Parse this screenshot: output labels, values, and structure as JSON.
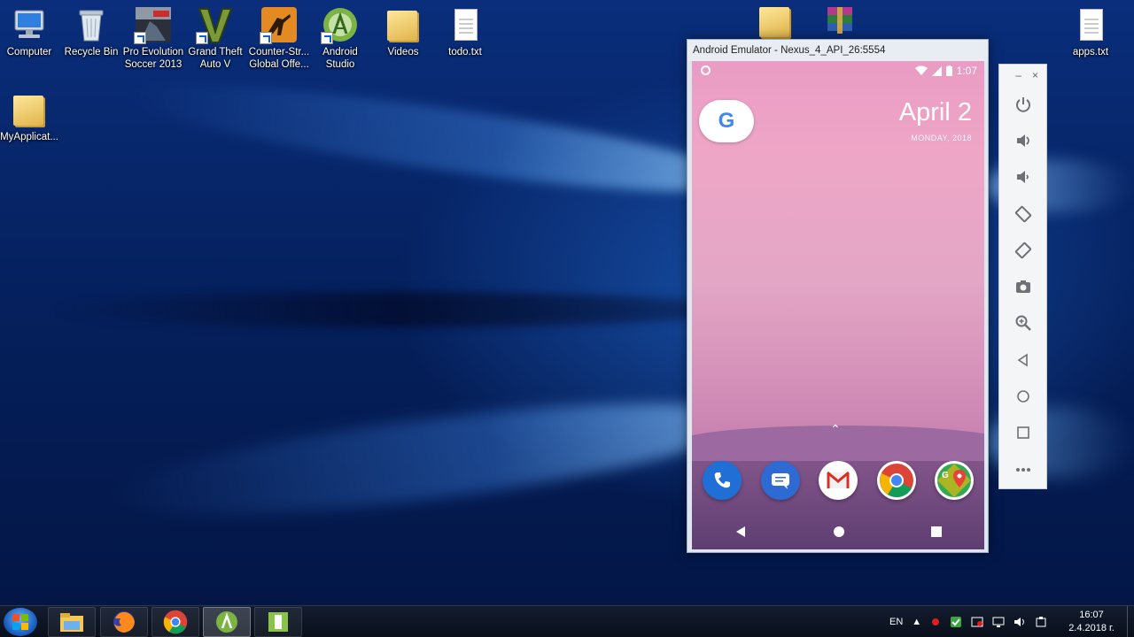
{
  "desktop": {
    "icons": [
      {
        "label": "Computer",
        "icon": "computer-icon"
      },
      {
        "label": "Recycle Bin",
        "icon": "recycle-bin-icon"
      },
      {
        "label_line1": "Pro Evolution",
        "label_line2": "Soccer 2013",
        "icon": "pes-game-icon"
      },
      {
        "label_line1": "Grand Theft",
        "label_line2": "Auto V",
        "icon": "gta-v-icon"
      },
      {
        "label_line1": "Counter-Str...",
        "label_line2": "Global Offe...",
        "icon": "csgo-icon"
      },
      {
        "label_line1": "Android",
        "label_line2": "Studio",
        "icon": "android-studio-icon"
      },
      {
        "label": "Videos",
        "icon": "folder-icon"
      },
      {
        "label": "todo.txt",
        "icon": "text-file-icon"
      },
      {
        "label": "apps.txt",
        "icon": "text-file-icon"
      },
      {
        "label": "MyApplicat...",
        "icon": "folder-icon"
      }
    ]
  },
  "emulator": {
    "window_title": "Android Emulator - Nexus_4_API_26:5554",
    "status_time": "1:07",
    "date_main": "April 2",
    "date_sub": "MONDAY, 2018",
    "google_letter": "G",
    "dock_apps": [
      "phone-app-icon",
      "messages-app-icon",
      "gmail-app-icon",
      "chrome-app-icon",
      "maps-app-icon"
    ],
    "toolbar": {
      "minimize": "–",
      "close": "×",
      "buttons": [
        "power-icon",
        "volume-up-icon",
        "volume-down-icon",
        "rotate-left-icon",
        "rotate-right-icon",
        "camera-icon",
        "zoom-icon",
        "back-icon",
        "home-icon",
        "overview-icon",
        "more-icon"
      ]
    }
  },
  "taskbar": {
    "apps": [
      "explorer-icon",
      "firefox-icon",
      "chrome-icon",
      "android-studio-taskbar-icon",
      "emulator-taskbar-icon"
    ],
    "language": "EN",
    "time": "16:07",
    "date": "2.4.2018 г."
  },
  "colors": {
    "wallpaper": "#0a2e7c",
    "accent": "#1a73e8"
  }
}
